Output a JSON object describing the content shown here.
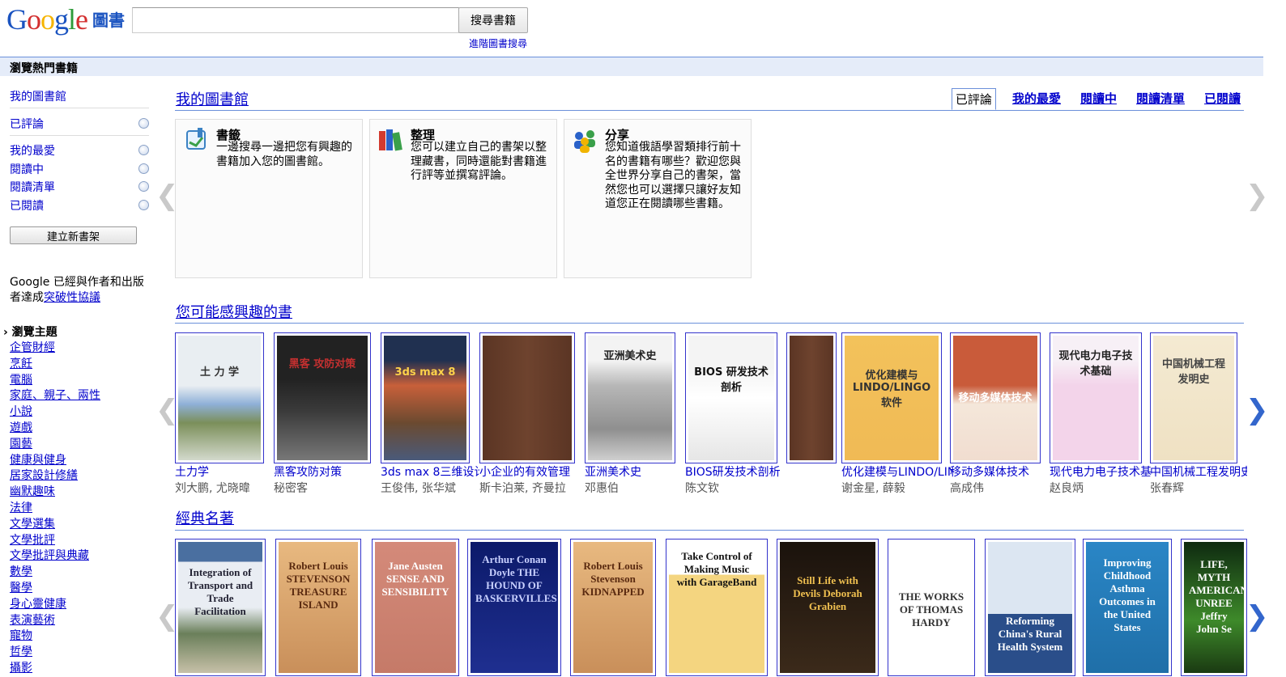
{
  "header": {
    "logo_text": "Google",
    "logo_sub": "圖書",
    "search_placeholder": "",
    "search_button": "搜尋書籍",
    "advanced_link": "進階圖書搜尋"
  },
  "topbar": {
    "title": "瀏覽熱門書籍"
  },
  "sidebar": {
    "my_library": "我的圖書館",
    "shelves": [
      "已評論",
      "我的最愛",
      "閱讀中",
      "閱讀清單",
      "已閱讀"
    ],
    "new_shelf_button": "建立新書架",
    "partner_text": "Google 已經與作者和出版者達成",
    "partner_link": "突破性協議",
    "topics_title": "瀏覽主題",
    "topics": [
      "企管財經",
      "烹飪",
      "電腦",
      "家庭、親子、兩性",
      "小說",
      "遊戲",
      "園藝",
      "健康與健身",
      "居家設計修繕",
      "幽默趣味",
      "法律",
      "文學選集",
      "文學批評",
      "文學批評與典藏",
      "數學",
      "醫學",
      "身心靈健康",
      "表演藝術",
      "寵物",
      "哲學",
      "攝影"
    ]
  },
  "library": {
    "title": "我的圖書館",
    "tabs": [
      "已評論",
      "我的最愛",
      "閱讀中",
      "閱讀清單",
      "已閱讀"
    ],
    "active_tab": "已評論",
    "cards": [
      {
        "title": "書籤",
        "desc": "一邊搜尋一邊把您有興趣的書籍加入您的圖書館。",
        "icon": "bookmark-icon"
      },
      {
        "title": "整理",
        "desc": "您可以建立自己的書架以整理藏書，同時還能對書籍進行評等並撰寫評論。",
        "icon": "books-icon"
      },
      {
        "title": "分享",
        "desc": "您知道俄語學習類排行前十名的書籍有哪些？歡迎您與全世界分享自己的書架，當然您也可以選擇只讓好友知道您正在閱讀哪些書籍。",
        "icon": "people-icon"
      }
    ]
  },
  "recommended": {
    "title": "您可能感興趣的書",
    "books": [
      {
        "title": "土力学",
        "author": "刘大鹏, 尤晓暐",
        "cover_text": "土 力 学"
      },
      {
        "title": "黑客攻防对策",
        "author": "秘密客",
        "cover_text": "黑客 攻防对策"
      },
      {
        "title": "3ds max 8三维设计",
        "author": "王俊伟, 张华斌",
        "cover_text": "3ds max 8"
      },
      {
        "title": "小企业的有效管理",
        "author": "斯卡泊莱, 齐曼拉",
        "cover_text": ""
      },
      {
        "title": "亚洲美术史",
        "author": "邓惠伯",
        "cover_text": "亚洲美术史"
      },
      {
        "title": "BIOS研发技术剖析",
        "author": "陈文钦",
        "cover_text": "BIOS 研发技术剖析"
      },
      {
        "title": "",
        "author": "",
        "cover_text": ""
      },
      {
        "title": "优化建模与LINDO/LINGO软件",
        "author": "谢金星, 薛毅",
        "cover_text": "优化建模与LINDO/LINGO软件"
      },
      {
        "title": "移动多媒体技术",
        "author": "高成伟",
        "cover_text": "移动多媒体技术"
      },
      {
        "title": "现代电力电子技术基础",
        "author": "赵良炳",
        "cover_text": "现代电力电子技术基础"
      },
      {
        "title": "中国机械工程发明史",
        "author": "张春辉",
        "cover_text": "中国机械工程发明史"
      }
    ]
  },
  "classics": {
    "title": "經典名著",
    "books": [
      {
        "cover_text": "Integration of Transport and Trade Facilitation"
      },
      {
        "cover_text": "Robert Louis STEVENSON TREASURE ISLAND"
      },
      {
        "cover_text": "Jane Austen SENSE AND SENSIBILITY"
      },
      {
        "cover_text": "Arthur Conan Doyle THE HOUND OF BASKERVILLES"
      },
      {
        "cover_text": "Robert Louis Stevenson KIDNAPPED"
      },
      {
        "cover_text": "Take Control of Making Music with GarageBand"
      },
      {
        "cover_text": "Still Life with Devils Deborah Grabien"
      },
      {
        "cover_text": "THE WORKS OF THOMAS HARDY"
      },
      {
        "cover_text": "Reforming China's Rural Health System"
      },
      {
        "cover_text": "Improving Childhood Asthma Outcomes in the United States"
      },
      {
        "cover_text": "LIFE, MYTH AMERICAN UNREE Jeffry John Se"
      }
    ]
  },
  "nav": {
    "left": "❮",
    "right": "❯"
  }
}
